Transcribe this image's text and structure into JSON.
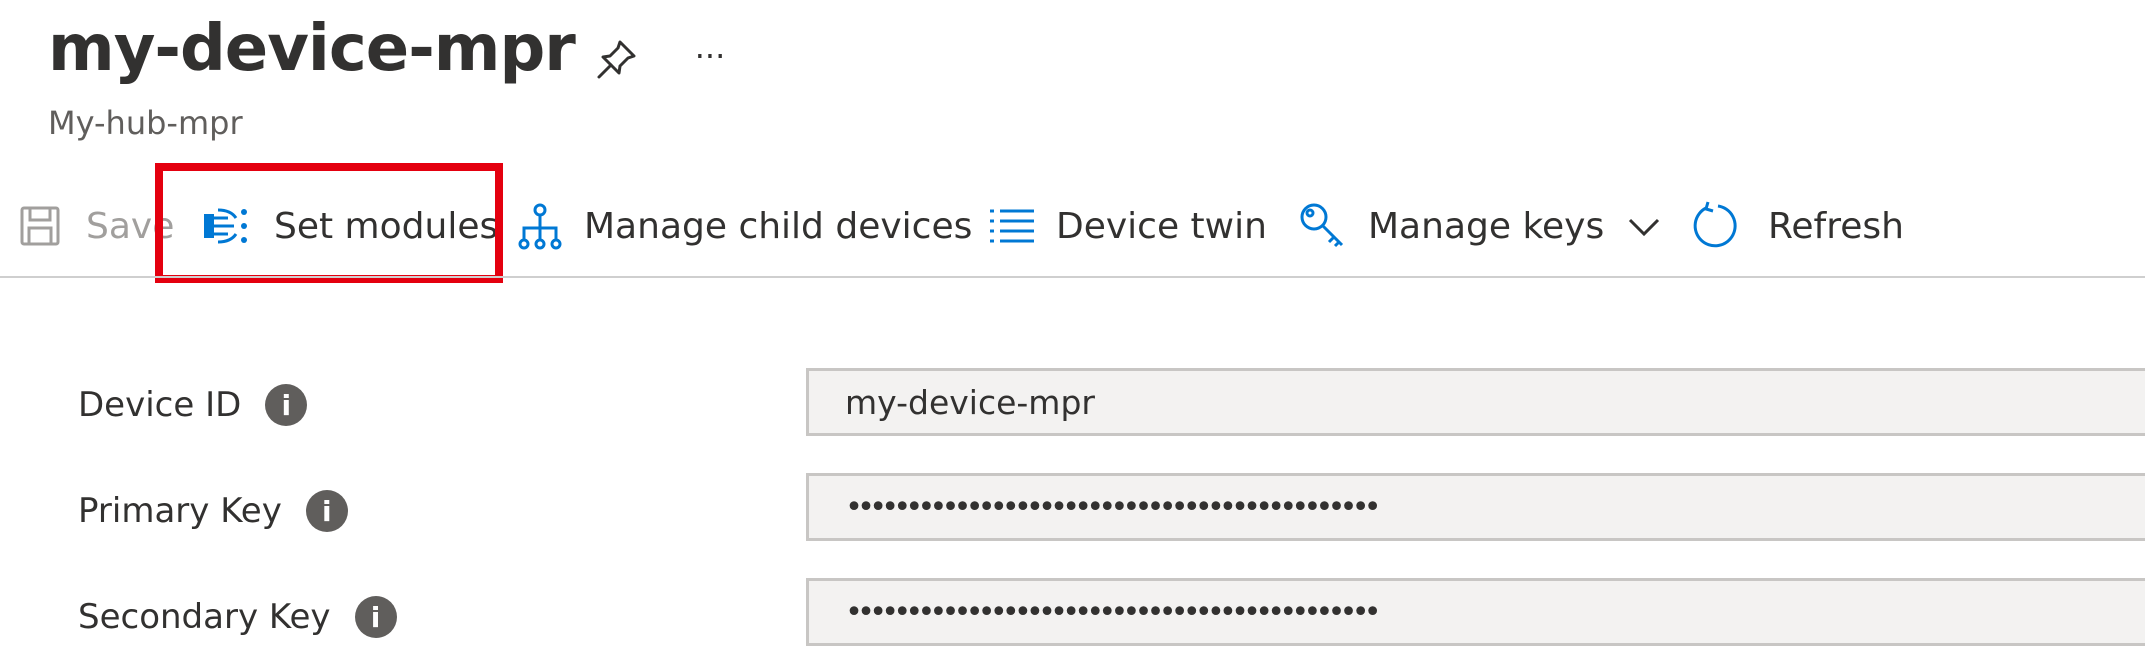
{
  "header": {
    "title": "my-device-mpr",
    "subtitle": "My-hub-mpr",
    "more_label": "···"
  },
  "toolbar": {
    "save_label": "Save",
    "set_modules_label": "Set modules",
    "manage_child_label": "Manage child devices",
    "device_twin_label": "Device twin",
    "manage_keys_label": "Manage keys",
    "refresh_label": "Refresh"
  },
  "form": {
    "device_id": {
      "label": "Device ID",
      "value": "my-device-mpr"
    },
    "primary_key": {
      "label": "Primary Key",
      "value": "••••••••••••••••••••••••••••••••••••••••••••"
    },
    "secondary_key": {
      "label": "Secondary Key",
      "value": "••••••••••••••••••••••••••••••••••••••••••••"
    },
    "info_glyph": "i"
  },
  "colors": {
    "accent": "#0078d4",
    "highlight": "#e4000f",
    "disabled": "#a19f9d"
  }
}
